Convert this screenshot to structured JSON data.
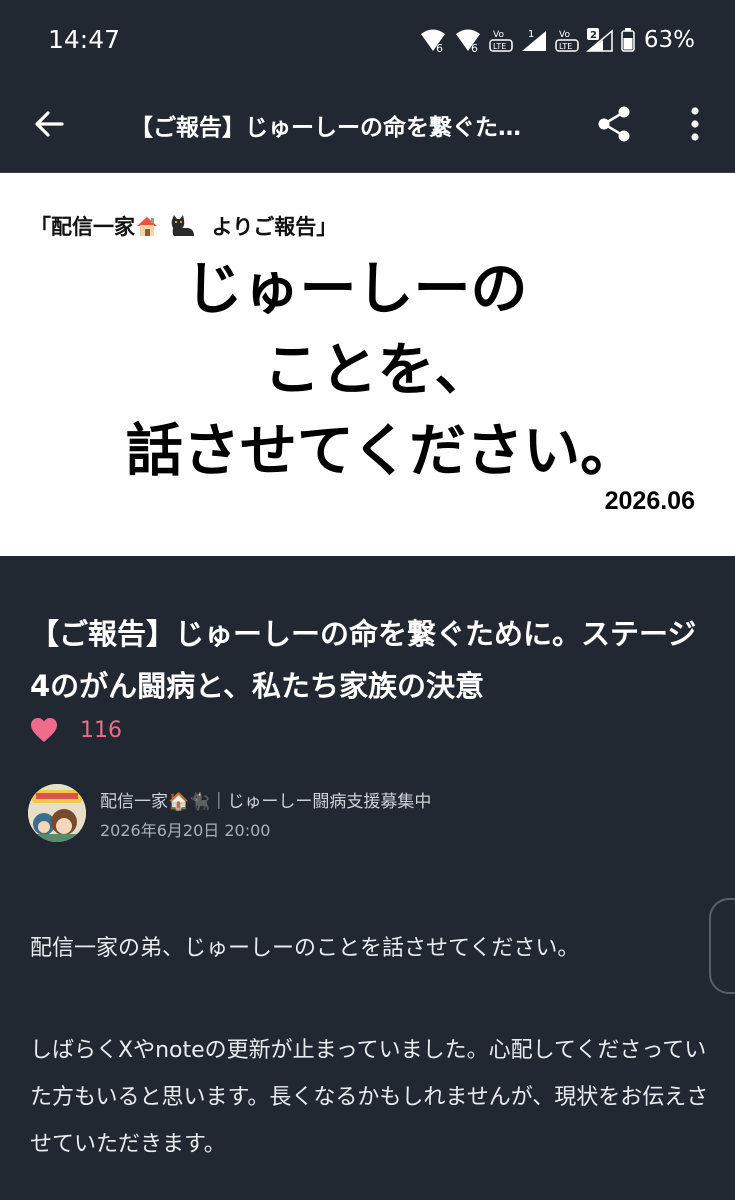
{
  "status_bar": {
    "time": "14:47",
    "battery": "63%",
    "icons": [
      "wifi-6-icon",
      "wifi-6-icon",
      "volte-icon",
      "signal-icon",
      "volte-icon",
      "signal-icon",
      "battery-icon"
    ],
    "sim1_label": "1",
    "sim2_label": "2",
    "lte_label": "LTE",
    "vo_label": "Vo",
    "wifi_label": "6"
  },
  "app_bar": {
    "title": "【ご報告】じゅーしーの命を繋ぐた…",
    "icons": [
      "back-arrow-icon",
      "share-icon",
      "more-vert-icon"
    ]
  },
  "header_image": {
    "kicker_prefix": "「配信一家",
    "kicker_suffix": "よりご報告」",
    "kicker_icons": [
      "house-icon",
      "black-cat-icon"
    ],
    "title_line1": "じゅーしーの",
    "title_line2": "ことを、",
    "title_line3": "話させてください。",
    "date": "2026.06"
  },
  "article": {
    "title": "【ご報告】じゅーしーの命を繋ぐために。ステージ4のがん闘病と、私たち家族の決意",
    "like_count": "116",
    "author_name": "配信一家🏠🐈‍⬛｜じゅーしー闘病支援募集中",
    "published": "2026年6月20日 20:00",
    "paragraphs": [
      "配信一家の弟、じゅーしーのことを話させてください。",
      "しばらくXやnoteの更新が止まっていました。心配してくださっていた方もいると思います。長くなるかもしれませんが、現状をお伝えさせていただきます。"
    ]
  },
  "colors": {
    "background": "#222831",
    "heart": "#f06b8a",
    "header_bg": "#ffffff"
  }
}
